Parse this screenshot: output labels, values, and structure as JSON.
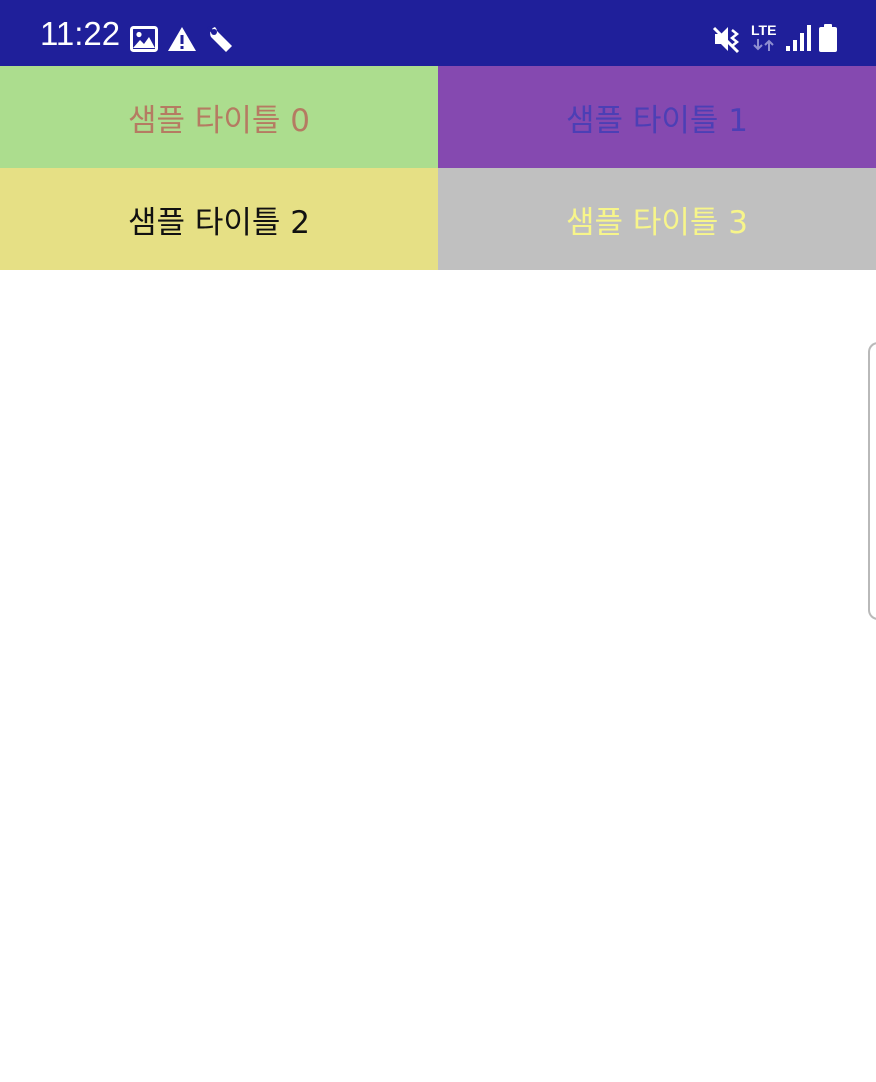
{
  "status_bar": {
    "time": "11:22",
    "network_label": "LTE",
    "background": "#1f1f9a",
    "left_icons": [
      "image-icon",
      "warning-icon",
      "wrench-icon"
    ],
    "right_icons": [
      "mute-vibrate-icon",
      "lte-data-icon",
      "signal-icon",
      "battery-icon"
    ]
  },
  "tiles": [
    {
      "title": "샘플 타이틀 0",
      "background": "#acdd8e",
      "text_color": "#b57b62"
    },
    {
      "title": "샘플 타이틀 1",
      "background": "#8549b0",
      "text_color": "#4c3fb5"
    },
    {
      "title": "샘플 타이틀 2",
      "background": "#e6e085",
      "text_color": "#111111"
    },
    {
      "title": "샘플 타이틀 3",
      "background": "#c0c0c0",
      "text_color": "#f7f58a"
    }
  ]
}
